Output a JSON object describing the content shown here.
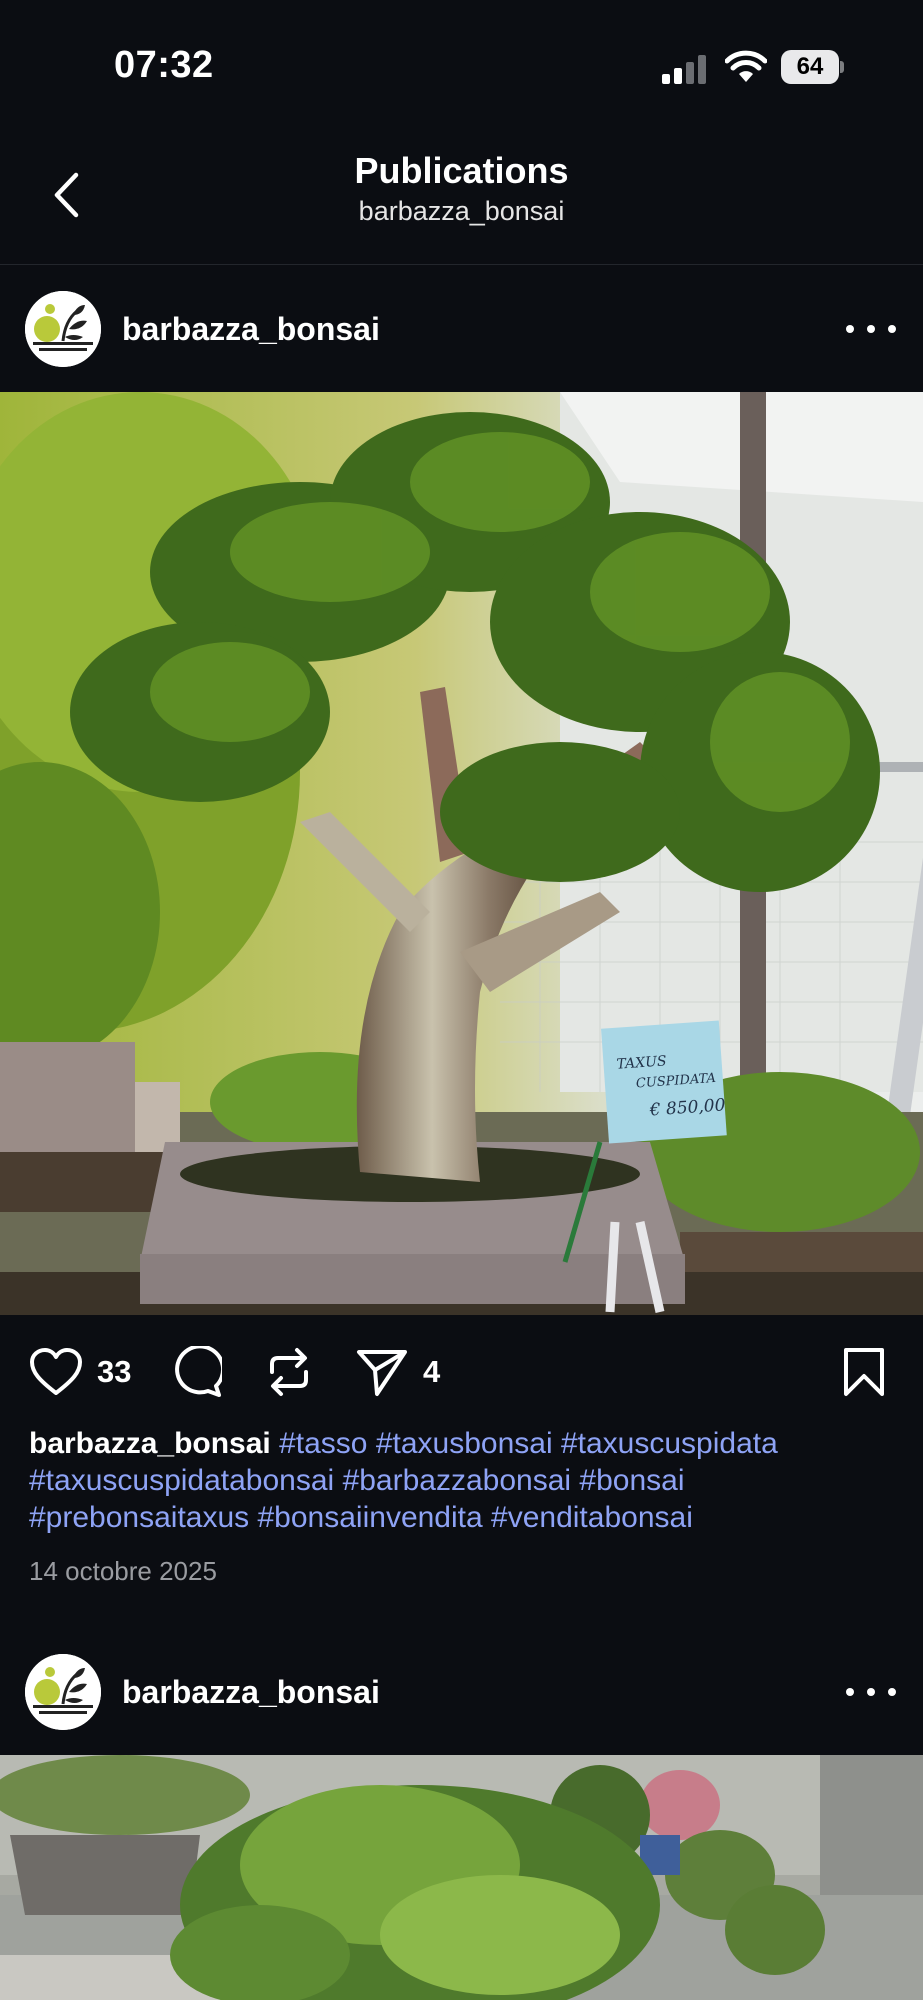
{
  "status_bar": {
    "time": "07:32",
    "battery": "64",
    "icons": [
      "signal-icon",
      "wifi-icon",
      "battery-icon"
    ]
  },
  "header": {
    "title": "Publications",
    "subtitle": "barbazza_bonsai",
    "back_icon": "chevron-left-icon"
  },
  "posts": [
    {
      "username": "barbazza_bonsai",
      "more_icon": "more-horizontal-icon",
      "image_description_icon": "bonsai-photo",
      "sign_text_1": "TAXUS",
      "sign_text_2": "CUSPIDATA",
      "sign_text_3": "€ 850,00",
      "likes": "33",
      "shares": "4",
      "caption_user": "barbazza_bonsai",
      "hashtags": [
        "#tasso",
        "#taxusbonsai",
        "#taxuscuspidata",
        "#taxuscuspidatabonsai",
        "#barbazzabonsai",
        "#bonsai",
        "#prebonsaitaxus",
        "#bonsaiinvendita",
        "#venditabonsai"
      ],
      "date": "14 octobre 2025"
    },
    {
      "username": "barbazza_bonsai",
      "more_icon": "more-horizontal-icon"
    }
  ],
  "colors": {
    "background": "#0b0d12",
    "hashtag": "#8ea3f5",
    "date": "#9a9ca1"
  }
}
